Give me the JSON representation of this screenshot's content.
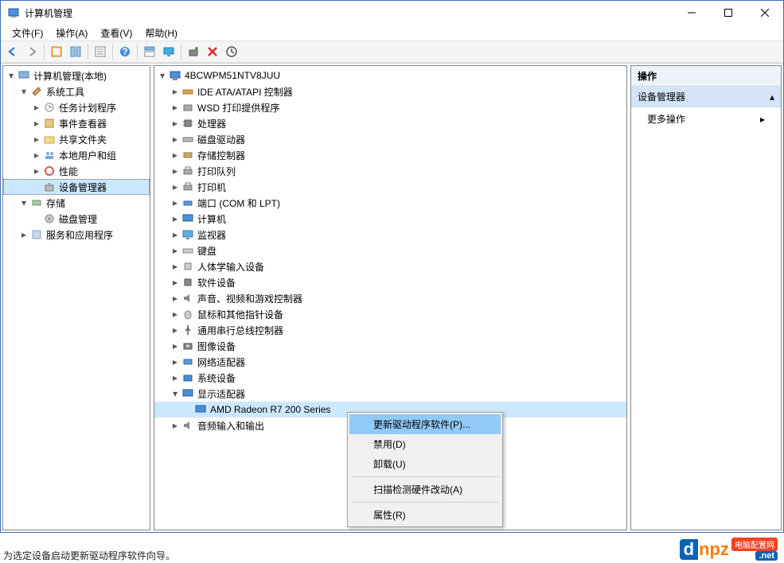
{
  "title": "计算机管理",
  "menu": {
    "file": "文件(F)",
    "action": "操作(A)",
    "view": "查看(V)",
    "help": "帮助(H)"
  },
  "left_tree": {
    "root": "计算机管理(本地)",
    "system_tools": "系统工具",
    "task_scheduler": "任务计划程序",
    "event_viewer": "事件查看器",
    "shared_folders": "共享文件夹",
    "local_users": "本地用户和组",
    "performance": "性能",
    "device_manager": "设备管理器",
    "storage": "存储",
    "disk_management": "磁盘管理",
    "services_apps": "服务和应用程序"
  },
  "device_tree": {
    "computer_name": "4BCWPM51NTV8JUU",
    "ide": "IDE ATA/ATAPI 控制器",
    "wsd": "WSD 打印提供程序",
    "processors": "处理器",
    "disk_drives": "磁盘驱动器",
    "storage_controllers": "存储控制器",
    "print_queues": "打印队列",
    "printers": "打印机",
    "ports": "端口 (COM 和 LPT)",
    "computer": "计算机",
    "monitors": "监视器",
    "keyboards": "键盘",
    "hid": "人体学输入设备",
    "software_devices": "软件设备",
    "sound": "声音、视频和游戏控制器",
    "mice": "鼠标和其他指针设备",
    "usb": "通用串行总线控制器",
    "imaging": "图像设备",
    "network": "网络适配器",
    "system_devices": "系统设备",
    "display_adapters": "显示适配器",
    "gpu": "AMD Radeon R7 200 Series",
    "audio_io": "音频输入和输出"
  },
  "actions_pane": {
    "header": "操作",
    "section": "设备管理器",
    "more_actions": "更多操作"
  },
  "context_menu": {
    "update_driver": "更新驱动程序软件(P)...",
    "disable": "禁用(D)",
    "uninstall": "卸载(U)",
    "scan_hardware": "扫描检测硬件改动(A)",
    "properties": "属性(R)"
  },
  "status_text": "为选定设备启动更新驱动程序软件向导。",
  "watermark": {
    "brand": "dnpz",
    "badge": "电脑配置网",
    "tld": ".net"
  }
}
